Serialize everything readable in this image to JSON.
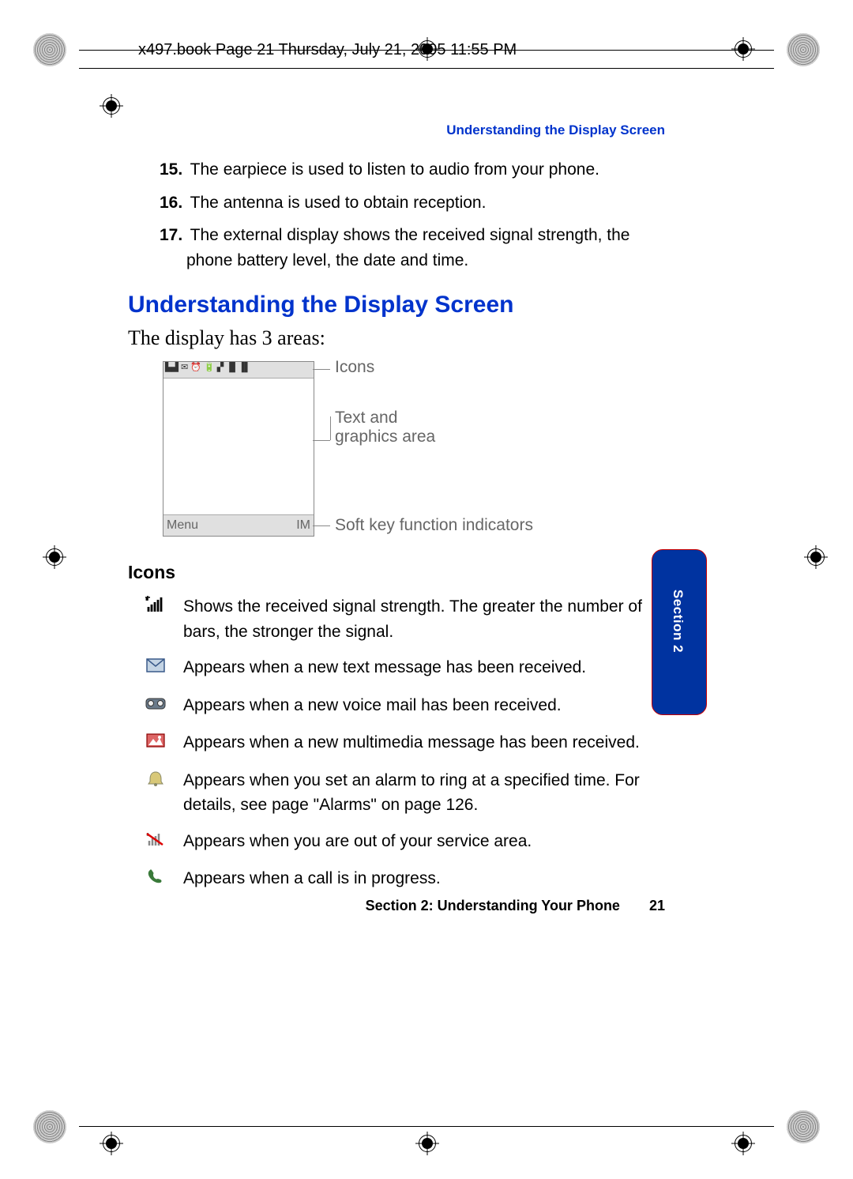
{
  "printHeader": "x497.book  Page 21  Thursday, July 21, 2005  11:55 PM",
  "runningHeader": "Understanding the Display Screen",
  "numberedItems": [
    {
      "num": "15.",
      "text": "The earpiece is used to listen to audio from your phone."
    },
    {
      "num": "16.",
      "text": "The antenna is used to obtain reception."
    },
    {
      "num": "17.",
      "text": "The external display shows the received signal strength, the phone battery level, the date and time."
    }
  ],
  "h2": "Understanding the Display Screen",
  "intro": "The display has 3 areas:",
  "diagram": {
    "iconsLabel": "Icons",
    "textAreaLabel": "Text and graphics area",
    "softkeyLabel": "Soft key function indicators",
    "menuLeft": "Menu",
    "menuRight": "IM"
  },
  "iconsHeading": "Icons",
  "iconEntries": [
    {
      "name": "signal-strength-icon",
      "text": "Shows the received signal strength. The greater the number of bars, the stronger the signal."
    },
    {
      "name": "text-message-icon",
      "text": "Appears when a new text message has been received."
    },
    {
      "name": "voicemail-icon",
      "text": "Appears when a new voice mail has been received."
    },
    {
      "name": "mms-icon",
      "text": "Appears when a new multimedia message has been received."
    },
    {
      "name": "alarm-icon",
      "text": "Appears when you set an alarm to ring at a specified time. For details, see page \"Alarms\" on page 126."
    },
    {
      "name": "no-service-icon",
      "text": "Appears when you are out of your service area."
    },
    {
      "name": "call-icon",
      "text": "Appears when a call is in progress."
    }
  ],
  "footerSection": "Section 2: Understanding Your Phone",
  "footerPage": "21",
  "tabLabel": "Section 2"
}
